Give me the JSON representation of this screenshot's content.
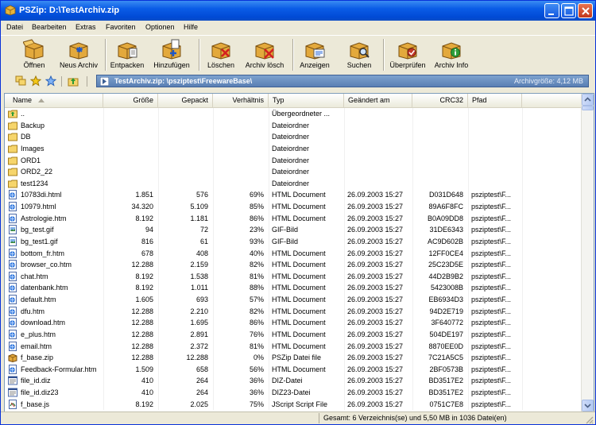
{
  "window": {
    "title": "PSZip: D:\\TestArchiv.zip"
  },
  "menu": [
    "Datei",
    "Bearbeiten",
    "Extras",
    "Favoriten",
    "Optionen",
    "Hilfe"
  ],
  "toolbar": [
    {
      "label": "Öffnen",
      "icon": "open-box-icon"
    },
    {
      "label": "Neus Archiv",
      "icon": "new-archive-icon"
    },
    {
      "label": "Entpacken",
      "icon": "extract-icon"
    },
    {
      "label": "Hinzufügen",
      "icon": "add-icon"
    },
    {
      "label": "Löschen",
      "icon": "delete-icon"
    },
    {
      "label": "Archiv lösch",
      "icon": "delete-archive-icon"
    },
    {
      "label": "Anzeigen",
      "icon": "view-icon"
    },
    {
      "label": "Suchen",
      "icon": "search-icon"
    },
    {
      "label": "Überprüfen",
      "icon": "test-icon"
    },
    {
      "label": "Archiv Info",
      "icon": "info-icon"
    }
  ],
  "address": {
    "path": "TestArchiv.zip: \\psziptest\\FreewareBase\\",
    "archive_size": "Archivgröße: 4,12 MB"
  },
  "columns": [
    "Name",
    "Größe",
    "Gepackt",
    "Verhältnis",
    "Typ",
    "Geändert am",
    "CRC32",
    "Pfad"
  ],
  "files": [
    {
      "name": "..",
      "size": "",
      "packed": "",
      "ratio": "",
      "type": "Übergeordneter ...",
      "date": "",
      "crc": "",
      "path": "",
      "icon": "up-folder"
    },
    {
      "name": "Backup",
      "size": "",
      "packed": "",
      "ratio": "",
      "type": "Dateiordner",
      "date": "",
      "crc": "",
      "path": "",
      "icon": "folder"
    },
    {
      "name": "DB",
      "size": "",
      "packed": "",
      "ratio": "",
      "type": "Dateiordner",
      "date": "",
      "crc": "",
      "path": "",
      "icon": "folder"
    },
    {
      "name": "Images",
      "size": "",
      "packed": "",
      "ratio": "",
      "type": "Dateiordner",
      "date": "",
      "crc": "",
      "path": "",
      "icon": "folder"
    },
    {
      "name": "ORD1",
      "size": "",
      "packed": "",
      "ratio": "",
      "type": "Dateiordner",
      "date": "",
      "crc": "",
      "path": "",
      "icon": "folder"
    },
    {
      "name": "ORD2_22",
      "size": "",
      "packed": "",
      "ratio": "",
      "type": "Dateiordner",
      "date": "",
      "crc": "",
      "path": "",
      "icon": "folder"
    },
    {
      "name": "test1234",
      "size": "",
      "packed": "",
      "ratio": "",
      "type": "Dateiordner",
      "date": "",
      "crc": "",
      "path": "",
      "icon": "folder"
    },
    {
      "name": "10783di.html",
      "size": "1.851",
      "packed": "576",
      "ratio": "69%",
      "type": "HTML Document",
      "date": "26.09.2003 15:27",
      "crc": "D031D648",
      "path": "psziptest\\F...",
      "icon": "html"
    },
    {
      "name": "10979.html",
      "size": "34.320",
      "packed": "5.109",
      "ratio": "85%",
      "type": "HTML Document",
      "date": "26.09.2003 15:27",
      "crc": "89A6F8FC",
      "path": "psziptest\\F...",
      "icon": "html"
    },
    {
      "name": "Astrologie.htm",
      "size": "8.192",
      "packed": "1.181",
      "ratio": "86%",
      "type": "HTML Document",
      "date": "26.09.2003 15:27",
      "crc": "B0A09DD8",
      "path": "psziptest\\F...",
      "icon": "html"
    },
    {
      "name": "bg_test.gif",
      "size": "94",
      "packed": "72",
      "ratio": "23%",
      "type": "GIF-Bild",
      "date": "26.09.2003 15:27",
      "crc": "31DE6343",
      "path": "psziptest\\F...",
      "icon": "gif"
    },
    {
      "name": "bg_test1.gif",
      "size": "816",
      "packed": "61",
      "ratio": "93%",
      "type": "GIF-Bild",
      "date": "26.09.2003 15:27",
      "crc": "AC9D602B",
      "path": "psziptest\\F...",
      "icon": "gif"
    },
    {
      "name": "bottom_fr.htm",
      "size": "678",
      "packed": "408",
      "ratio": "40%",
      "type": "HTML Document",
      "date": "26.09.2003 15:27",
      "crc": "12FF0CE4",
      "path": "psziptest\\F...",
      "icon": "html"
    },
    {
      "name": "browser_co.htm",
      "size": "12.288",
      "packed": "2.159",
      "ratio": "82%",
      "type": "HTML Document",
      "date": "26.09.2003 15:27",
      "crc": "25C23D5E",
      "path": "psziptest\\F...",
      "icon": "html"
    },
    {
      "name": "chat.htm",
      "size": "8.192",
      "packed": "1.538",
      "ratio": "81%",
      "type": "HTML Document",
      "date": "26.09.2003 15:27",
      "crc": "44D2B9B2",
      "path": "psziptest\\F...",
      "icon": "html"
    },
    {
      "name": "datenbank.htm",
      "size": "8.192",
      "packed": "1.011",
      "ratio": "88%",
      "type": "HTML Document",
      "date": "26.09.2003 15:27",
      "crc": "5423008B",
      "path": "psziptest\\F...",
      "icon": "html"
    },
    {
      "name": "default.htm",
      "size": "1.605",
      "packed": "693",
      "ratio": "57%",
      "type": "HTML Document",
      "date": "26.09.2003 15:27",
      "crc": "EB6934D3",
      "path": "psziptest\\F...",
      "icon": "html"
    },
    {
      "name": "dfu.htm",
      "size": "12.288",
      "packed": "2.210",
      "ratio": "82%",
      "type": "HTML Document",
      "date": "26.09.2003 15:27",
      "crc": "94D2E719",
      "path": "psziptest\\F...",
      "icon": "html"
    },
    {
      "name": "download.htm",
      "size": "12.288",
      "packed": "1.695",
      "ratio": "86%",
      "type": "HTML Document",
      "date": "26.09.2003 15:27",
      "crc": "3F640772",
      "path": "psziptest\\F...",
      "icon": "html"
    },
    {
      "name": "e_plus.htm",
      "size": "12.288",
      "packed": "2.891",
      "ratio": "76%",
      "type": "HTML Document",
      "date": "26.09.2003 15:27",
      "crc": "504DE197",
      "path": "psziptest\\F...",
      "icon": "html"
    },
    {
      "name": "email.htm",
      "size": "12.288",
      "packed": "2.372",
      "ratio": "81%",
      "type": "HTML Document",
      "date": "26.09.2003 15:27",
      "crc": "8870EE0D",
      "path": "psziptest\\F...",
      "icon": "html"
    },
    {
      "name": "f_base.zip",
      "size": "12.288",
      "packed": "12.288",
      "ratio": "0%",
      "type": "PSZip Datei file",
      "date": "26.09.2003 15:27",
      "crc": "7C21A5C5",
      "path": "psziptest\\F...",
      "icon": "zip"
    },
    {
      "name": "Feedback-Formular.htm",
      "size": "1.509",
      "packed": "658",
      "ratio": "56%",
      "type": "HTML Document",
      "date": "26.09.2003 15:27",
      "crc": "2BF0573B",
      "path": "psziptest\\F...",
      "icon": "html"
    },
    {
      "name": "file_id.diz",
      "size": "410",
      "packed": "264",
      "ratio": "36%",
      "type": "DIZ-Datei",
      "date": "26.09.2003 15:27",
      "crc": "BD3517E2",
      "path": "psziptest\\F...",
      "icon": "diz"
    },
    {
      "name": "file_id.diz23",
      "size": "410",
      "packed": "264",
      "ratio": "36%",
      "type": "DIZ23-Datei",
      "date": "26.09.2003 15:27",
      "crc": "BD3517E2",
      "path": "psziptest\\F...",
      "icon": "diz"
    },
    {
      "name": "f_base.js",
      "size": "8.192",
      "packed": "2.025",
      "ratio": "75%",
      "type": "JScript Script File",
      "date": "26.09.2003 15:27",
      "crc": "0751C7E8",
      "path": "psziptest\\F...",
      "icon": "js"
    }
  ],
  "status": "Gesamt: 6 Verzeichnis(se) und  5,50 MB in 1036 Datei(en)"
}
